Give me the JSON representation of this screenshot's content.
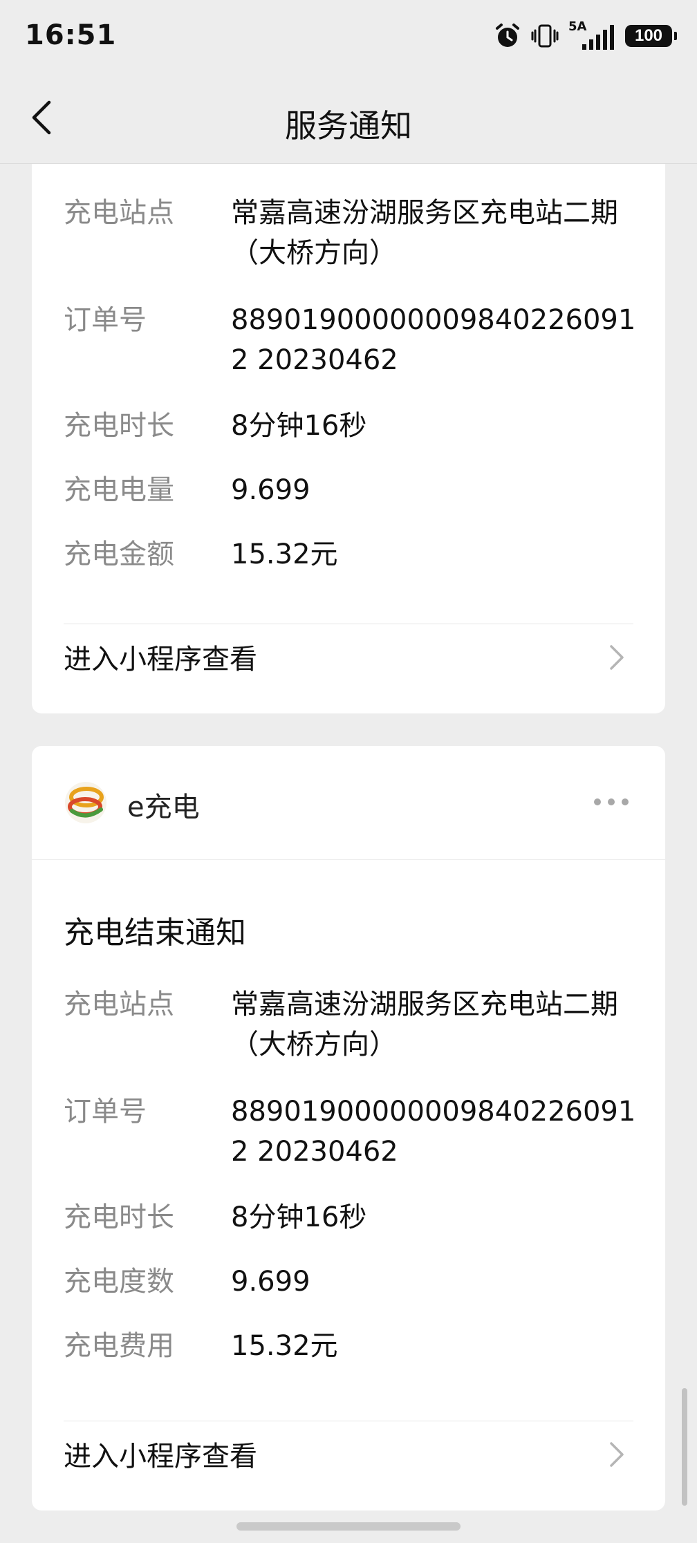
{
  "status_bar": {
    "time": "16:51",
    "network": "5A",
    "battery": "100"
  },
  "nav": {
    "title": "服务通知"
  },
  "card1": {
    "rows": [
      {
        "label": "充电站点",
        "value": "常嘉高速汾湖服务区充电站二期（大桥方向）"
      },
      {
        "label": "订单号",
        "value": "889019000000098402260912 20230462"
      },
      {
        "label": "充电时长",
        "value": "8分钟16秒"
      },
      {
        "label": "充电电量",
        "value": "9.699"
      },
      {
        "label": "充电金额",
        "value": "15.32元"
      }
    ],
    "link_label": "进入小程序查看"
  },
  "card2": {
    "brand_name": "e充电",
    "title": "充电结束通知",
    "rows": [
      {
        "label": "充电站点",
        "value": "常嘉高速汾湖服务区充电站二期（大桥方向）"
      },
      {
        "label": "订单号",
        "value": "889019000000098402260912 20230462"
      },
      {
        "label": "充电时长",
        "value": "8分钟16秒"
      },
      {
        "label": "充电度数",
        "value": "9.699"
      },
      {
        "label": "充电费用",
        "value": "15.32元"
      }
    ],
    "link_label": "进入小程序查看"
  },
  "colors": {
    "background": "#ededed",
    "card": "#ffffff",
    "label": "#8a8a8a",
    "text": "#111111"
  },
  "icons": {
    "back": "chevron-left-icon",
    "more": "more-dots-icon",
    "link": "chevron-right-icon",
    "brand": "e-charge-logo"
  }
}
